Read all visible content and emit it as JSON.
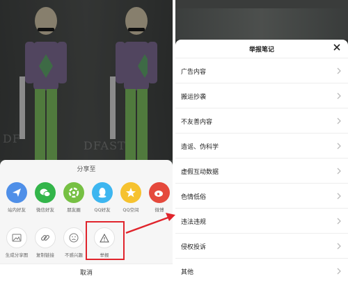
{
  "share_sheet": {
    "title": "分享至",
    "row1": [
      {
        "label": "站内好友",
        "icon": "paper-plane-icon",
        "color": "#4f8fe8"
      },
      {
        "label": "微信好友",
        "icon": "wechat-icon",
        "color": "#33b54a"
      },
      {
        "label": "朋友圈",
        "icon": "moments-icon",
        "color": "#76c043"
      },
      {
        "label": "QQ好友",
        "icon": "qq-icon",
        "color": "#3db6f0"
      },
      {
        "label": "QQ空间",
        "icon": "qzone-star-icon",
        "color": "#f6c22f"
      },
      {
        "label": "微博",
        "icon": "weibo-icon",
        "color": "#e5493c"
      }
    ],
    "row2": [
      {
        "label": "生成分享图",
        "icon": "image-icon"
      },
      {
        "label": "复制链接",
        "icon": "link-icon"
      },
      {
        "label": "不感兴趣",
        "icon": "sad-face-icon"
      },
      {
        "label": "举报",
        "icon": "warning-triangle-icon"
      }
    ],
    "cancel_label": "取消"
  },
  "photo_watermark": "DFAST",
  "highlight_color": "#e0242c",
  "report_sheet": {
    "title": "举报笔记",
    "reasons": [
      "广告内容",
      "搬运抄袭",
      "不友善内容",
      "造谣、伪科学",
      "虚假互动数据",
      "色情低俗",
      "违法违规",
      "侵权投诉",
      "其他"
    ]
  }
}
